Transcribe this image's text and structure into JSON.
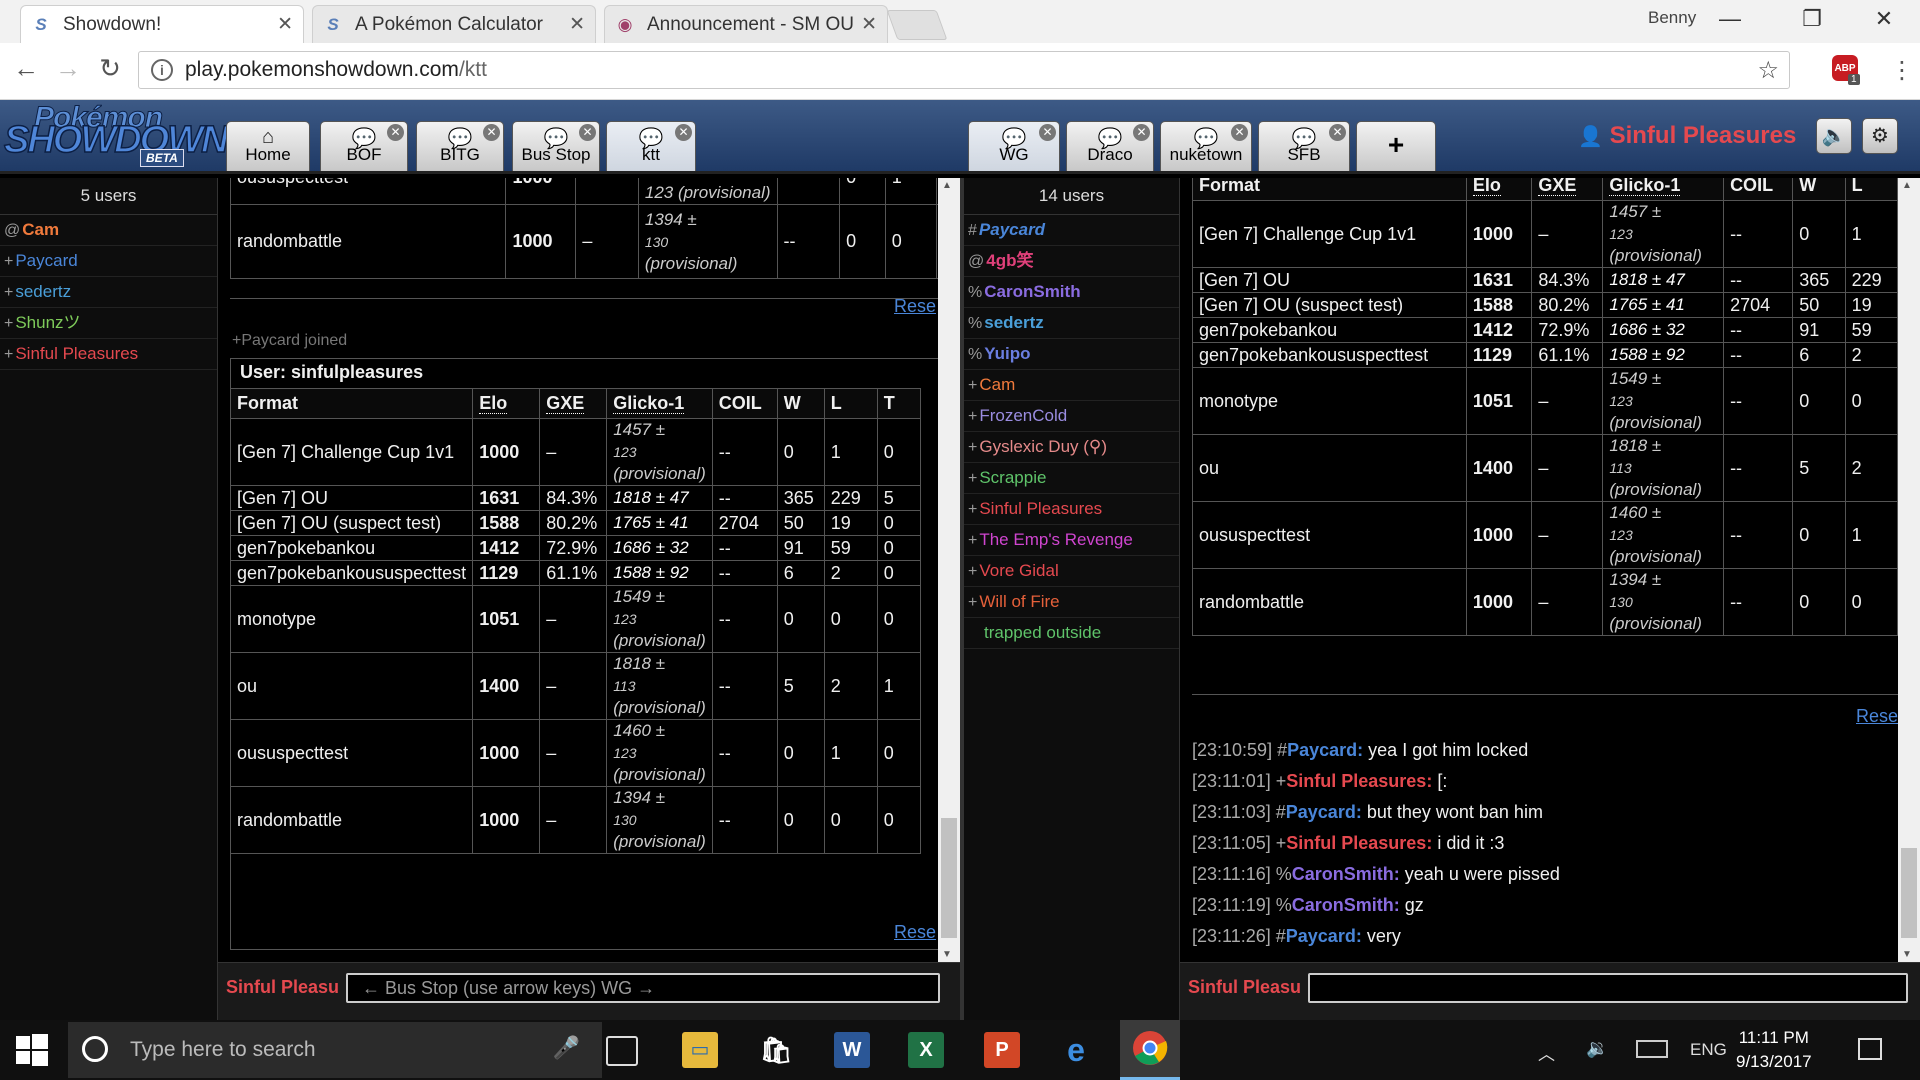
{
  "browser": {
    "tabs": [
      {
        "label": "Showdown!",
        "icon": "S"
      },
      {
        "label": "A Pokémon Calculator",
        "icon": "S"
      },
      {
        "label": "Announcement - SM OU",
        "icon": "forum-icon"
      }
    ],
    "profile": "Benny",
    "url_host": "play.pokemonshowdown.com",
    "url_path": "/ktt",
    "abp_label": "ABP",
    "abp_count": "1"
  },
  "header": {
    "logo_line1": "Pokémon",
    "logo_line2": "SHOWDOWN",
    "logo_beta": "BETA",
    "left_tabs": [
      {
        "label": "Home",
        "icon": "home-icon"
      },
      {
        "label": "BOF",
        "icon": "chat-icon"
      },
      {
        "label": "BITG",
        "icon": "chat-icon"
      },
      {
        "label": "Bus Stop",
        "icon": "chat-icon"
      },
      {
        "label": "ktt",
        "icon": "chat-icon"
      }
    ],
    "right_tabs": [
      {
        "label": "WG",
        "icon": "chat-icon"
      },
      {
        "label": "Draco",
        "icon": "chat-icon"
      },
      {
        "label": "nuketown",
        "icon": "chat-icon"
      },
      {
        "label": "SFB",
        "icon": "chat-icon"
      }
    ],
    "add_tab": "+",
    "username": "Sinful Pleasures",
    "colors": {
      "username": "#e5494f",
      "header_bg": "#2b4a78"
    }
  },
  "left_room": {
    "user_count": "5 users",
    "users": [
      {
        "rank": "@",
        "name": "Cam",
        "color": "#f07a3c",
        "bold": true
      },
      {
        "rank": "+",
        "name": "Paycard",
        "color": "#4a86d9"
      },
      {
        "rank": "+",
        "name": "sedertz",
        "color": "#4a9fd9"
      },
      {
        "rank": "+",
        "name": "Shunzツ",
        "color": "#7ecb5a"
      },
      {
        "rank": "+",
        "name": "Sinful Pleasures",
        "color": "#e5494f"
      }
    ],
    "top_table_partial": {
      "cut_row": {
        "format": "oususpecttest",
        "elo": "1000",
        "glicko_tail": "123 (provisional)",
        "w": "0",
        "l": "1"
      },
      "last_row": {
        "format": "randombattle",
        "elo": "1000",
        "gxe": "–",
        "glicko": "1394 ±",
        "dev": "130",
        "prov": "(provisional)",
        "coil": "--",
        "w": "0",
        "l": "0"
      }
    },
    "reset_label": "Rese",
    "joined_text": "+Paycard joined",
    "user_label": "User:",
    "user_name": "sinfulpleasures",
    "headers": [
      "Format",
      "Elo",
      "GXE",
      "Glicko-1",
      "COIL",
      "W",
      "L",
      "T"
    ],
    "rows": [
      {
        "format": "[Gen 7] Challenge Cup 1v1",
        "elo": "1000",
        "gxe": "–",
        "glicko": "1457 ±",
        "dev": "123",
        "prov": "(provisional)",
        "coil": "--",
        "w": "0",
        "l": "1",
        "t": "0"
      },
      {
        "format": "[Gen 7] OU",
        "elo": "1631",
        "gxe": "84.3%",
        "glicko": "1818 ± 47",
        "coil": "--",
        "w": "365",
        "l": "229",
        "t": "5"
      },
      {
        "format": "[Gen 7] OU (suspect test)",
        "elo": "1588",
        "gxe": "80.2%",
        "glicko": "1765 ± 41",
        "coil": "2704",
        "w": "50",
        "l": "19",
        "t": "0"
      },
      {
        "format": "gen7pokebankou",
        "elo": "1412",
        "gxe": "72.9%",
        "glicko": "1686 ± 32",
        "coil": "--",
        "w": "91",
        "l": "59",
        "t": "0"
      },
      {
        "format": "gen7pokebankoususpecttest",
        "elo": "1129",
        "gxe": "61.1%",
        "glicko": "1588 ± 92",
        "coil": "--",
        "w": "6",
        "l": "2",
        "t": "0"
      },
      {
        "format": "monotype",
        "elo": "1051",
        "gxe": "–",
        "glicko": "1549 ±",
        "dev": "123",
        "prov": "(provisional)",
        "coil": "--",
        "w": "0",
        "l": "0",
        "t": "0"
      },
      {
        "format": "ou",
        "elo": "1400",
        "gxe": "–",
        "glicko": "1818 ±",
        "dev": "113",
        "prov": "(provisional)",
        "coil": "--",
        "w": "5",
        "l": "2",
        "t": "1"
      },
      {
        "format": "oususpecttest",
        "elo": "1000",
        "gxe": "–",
        "glicko": "1460 ±",
        "dev": "123",
        "prov": "(provisional)",
        "coil": "--",
        "w": "0",
        "l": "1",
        "t": "0"
      },
      {
        "format": "randombattle",
        "elo": "1000",
        "gxe": "–",
        "glicko": "1394 ±",
        "dev": "130",
        "prov": "(provisional)",
        "coil": "--",
        "w": "0",
        "l": "0",
        "t": "0"
      }
    ],
    "composer_name": "Sinful Pleasu",
    "composer_placeholder": "← Bus Stop (use arrow keys) WG →"
  },
  "right_room": {
    "user_count": "14 users",
    "users": [
      {
        "rank": "#",
        "name": "Paycard",
        "color": "#4a86d9",
        "bold": true,
        "italic": true
      },
      {
        "rank": "@",
        "name": "4gb笑",
        "color": "#e0407a",
        "bold": true
      },
      {
        "rank": "%",
        "name": "CaronSmith",
        "color": "#8a6ce0",
        "bold": true
      },
      {
        "rank": "%",
        "name": "sedertz",
        "color": "#4a9fd9",
        "bold": true
      },
      {
        "rank": "%",
        "name": "Yuipo",
        "color": "#6a7ee0",
        "bold": true
      },
      {
        "rank": "+",
        "name": "Cam",
        "color": "#f07a3c"
      },
      {
        "rank": "+",
        "name": "FrozenCold",
        "color": "#9a8ce0"
      },
      {
        "rank": "+",
        "name": "Gyslexic Duy (⚲)",
        "color": "#e58a8a"
      },
      {
        "rank": "+",
        "name": "Scrappie",
        "color": "#5fc46a"
      },
      {
        "rank": "+",
        "name": "Sinful Pleasures",
        "color": "#e5494f"
      },
      {
        "rank": "+",
        "name": "The Emp's Revenge",
        "color": "#d045d0"
      },
      {
        "rank": "+",
        "name": "Vore Gidal",
        "color": "#e5494f"
      },
      {
        "rank": "+",
        "name": "Will of Fire",
        "color": "#e5603a"
      },
      {
        "rank": "",
        "name": "trapped outside",
        "color": "#5fc46a"
      }
    ],
    "headers": [
      "Format",
      "Elo",
      "GXE",
      "Glicko-1",
      "COIL",
      "W",
      "L"
    ],
    "rows": [
      {
        "format": "[Gen 7] Challenge Cup 1v1",
        "elo": "1000",
        "gxe": "–",
        "glicko": "1457 ±",
        "dev": "123",
        "prov": "(provisional)",
        "coil": "--",
        "w": "0",
        "l": "1"
      },
      {
        "format": "[Gen 7] OU",
        "elo": "1631",
        "gxe": "84.3%",
        "glicko": "1818 ± 47",
        "coil": "--",
        "w": "365",
        "l": "229"
      },
      {
        "format": "[Gen 7] OU (suspect test)",
        "elo": "1588",
        "gxe": "80.2%",
        "glicko": "1765 ± 41",
        "coil": "2704",
        "w": "50",
        "l": "19"
      },
      {
        "format": "gen7pokebankou",
        "elo": "1412",
        "gxe": "72.9%",
        "glicko": "1686 ± 32",
        "coil": "--",
        "w": "91",
        "l": "59"
      },
      {
        "format": "gen7pokebankoususpecttest",
        "elo": "1129",
        "gxe": "61.1%",
        "glicko": "1588 ± 92",
        "coil": "--",
        "w": "6",
        "l": "2"
      },
      {
        "format": "monotype",
        "elo": "1051",
        "gxe": "–",
        "glicko": "1549 ±",
        "dev": "123",
        "prov": "(provisional)",
        "coil": "--",
        "w": "0",
        "l": "0"
      },
      {
        "format": "ou",
        "elo": "1400",
        "gxe": "–",
        "glicko": "1818 ±",
        "dev": "113",
        "prov": "(provisional)",
        "coil": "--",
        "w": "5",
        "l": "2"
      },
      {
        "format": "oususpecttest",
        "elo": "1000",
        "gxe": "–",
        "glicko": "1460 ±",
        "dev": "123",
        "prov": "(provisional)",
        "coil": "--",
        "w": "0",
        "l": "1"
      },
      {
        "format": "randombattle",
        "elo": "1000",
        "gxe": "–",
        "glicko": "1394 ±",
        "dev": "130",
        "prov": "(provisional)",
        "coil": "--",
        "w": "0",
        "l": "0"
      }
    ],
    "reset_label": "Rese",
    "chat": [
      {
        "time": "[23:10:59]",
        "rank": "#",
        "name": "Paycard:",
        "color": "#4a86d9",
        "msg": "yea I got him locked"
      },
      {
        "time": "[23:11:01]",
        "rank": "+",
        "name": "Sinful Pleasures:",
        "color": "#e5494f",
        "msg": "[:"
      },
      {
        "time": "[23:11:03]",
        "rank": "#",
        "name": "Paycard:",
        "color": "#4a86d9",
        "msg": "but they wont ban him"
      },
      {
        "time": "[23:11:05]",
        "rank": "+",
        "name": "Sinful Pleasures:",
        "color": "#e5494f",
        "msg": "i did it :3"
      },
      {
        "time": "[23:11:16]",
        "rank": "%",
        "name": "CaronSmith:",
        "color": "#8a6ce0",
        "msg": "yeah u were pissed"
      },
      {
        "time": "[23:11:19]",
        "rank": "%",
        "name": "CaronSmith:",
        "color": "#8a6ce0",
        "msg": "gz"
      },
      {
        "time": "[23:11:26]",
        "rank": "#",
        "name": "Paycard:",
        "color": "#4a86d9",
        "msg": "very"
      }
    ],
    "composer_name": "Sinful Pleasu"
  },
  "taskbar": {
    "search_placeholder": "Type here to search",
    "lang": "ENG",
    "time": "11:11 PM",
    "date": "9/13/2017"
  }
}
